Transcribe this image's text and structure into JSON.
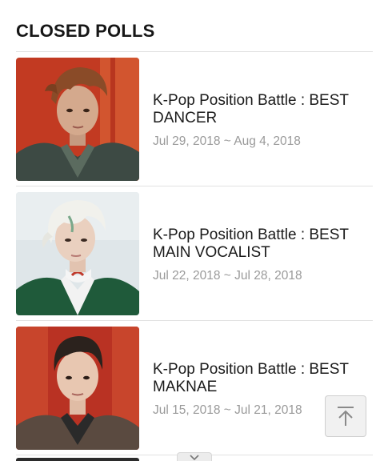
{
  "section": {
    "title": "CLOSED POLLS"
  },
  "polls": [
    {
      "title": "K-Pop Position Battle : BEST DANCER",
      "dates": "Jul 29, 2018 ~ Aug 4, 2018"
    },
    {
      "title": "K-Pop Position Battle : BEST MAIN VOCALIST",
      "dates": "Jul 22, 2018 ~ Jul 28, 2018"
    },
    {
      "title": "K-Pop Position Battle : BEST MAKNAE",
      "dates": "Jul 15, 2018 ~ Jul 21, 2018"
    }
  ],
  "controls": {
    "back_to_top_icon": "arrow-up-icon",
    "more_icon": "chevron-down-icon"
  },
  "colors": {
    "divider": "#e2e2e2",
    "date_text": "#9a9a9a",
    "red_backdrop": "#c0392b",
    "light_backdrop": "#dfe6e9"
  }
}
